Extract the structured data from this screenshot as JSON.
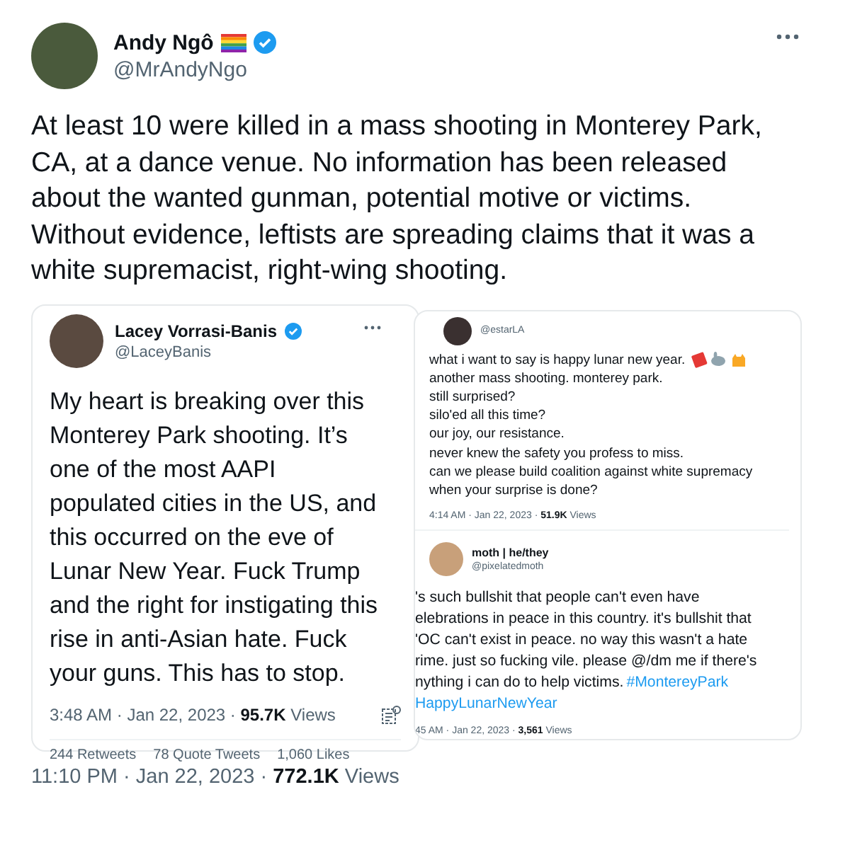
{
  "tweet": {
    "name": "Andy Ngô",
    "handle": "@MrAndyNgo",
    "verified": true,
    "flag": true,
    "text": "At least 10 were killed in a mass shooting in Monterey Park, CA, at a dance venue. No information has been released about the wanted gunman, potential motive or victims. Without evidence, leftists are spreading claims that it was a white supremacist, right-wing shooting.",
    "time": "11:10 PM · Jan 22, 2023 · ",
    "views_count": "772.1K",
    "views_label": " Views"
  },
  "embedded_left": {
    "name": "Lacey Vorrasi-Banis",
    "handle": "@LaceyBanis",
    "verified": true,
    "text": "My heart is breaking over this Monterey Park shooting. It’s one of the most AAPI populated cities in the US, and this occurred on the eve of Lunar New Year. Fuck Trump and the right for instigating this rise in anti-Asian hate. Fuck your guns. This has to stop.",
    "time": "3:48 AM · Jan 22, 2023 · ",
    "views_count": "95.7K",
    "views_label": " Views",
    "stats": [
      "244 Retweets",
      "78 Quote Tweets",
      "1,060 Likes"
    ]
  },
  "embedded_right": [
    {
      "handle": "@estarLA",
      "lines": [
        {
          "text": "what i want to say is happy lunar new year.",
          "emoji": true
        },
        {
          "text": "another mass shooting. monterey park."
        },
        {
          "text": "still surprised?"
        },
        {
          "text": "silo'ed all this time?"
        },
        {
          "text": "our joy, our resistance."
        },
        {
          "text": "never knew the safety you profess to miss."
        },
        {
          "text": "can we please build coalition against white supremacy"
        },
        {
          "text": "when your surprise is done?"
        }
      ],
      "time": "4:14 AM · Jan 22, 2023 · ",
      "views_count": "51.9K",
      "views_label": " Views"
    },
    {
      "name": "moth | he/they",
      "handle": "@pixelatedmoth",
      "lines": [
        {
          "text": "'s such bullshit that people can't even have"
        },
        {
          "text": "elebrations in peace in this country. it's bullshit that"
        },
        {
          "text": "'OC can't exist in peace. no way this wasn't a hate"
        },
        {
          "text": "rime. just so fucking vile. please @/dm me if there's"
        },
        {
          "text": "nything i can do to help victims. ",
          "tag": "#MontereyPark"
        },
        {
          "tag": "HappyLunarNewYear"
        }
      ],
      "time": "45 AM · Jan 22, 2023 · ",
      "views_count": "3,561",
      "views_label": " Views"
    }
  ]
}
